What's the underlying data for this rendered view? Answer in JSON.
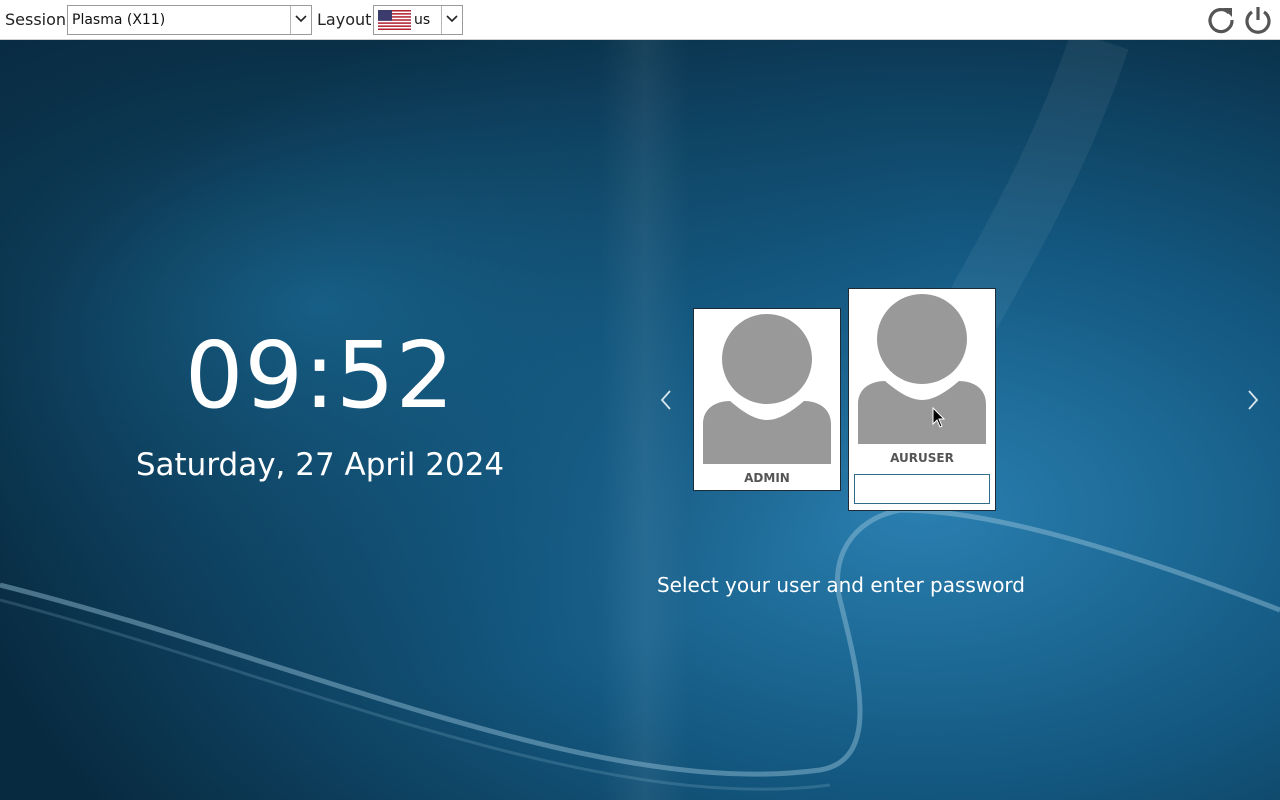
{
  "topbar": {
    "session_label": "Session",
    "session_value": "Plasma (X11)",
    "layout_label": "Layout",
    "layout_value": "us",
    "layout_flag_icon": "us-flag-icon",
    "restart_icon": "restart-icon",
    "shutdown_icon": "power-icon"
  },
  "clock": {
    "time": "09:52",
    "date": "Saturday, 27 April 2024"
  },
  "users": [
    {
      "name": "ADMIN",
      "selected": false
    },
    {
      "name": "AURUSER",
      "selected": true
    }
  ],
  "login": {
    "password_value": "",
    "prompt": "Select your user and enter password"
  },
  "colors": {
    "background": "#0f3a57",
    "card_border": "#1d2b36",
    "avatar": "#999999",
    "text_light": "#ffffff"
  }
}
